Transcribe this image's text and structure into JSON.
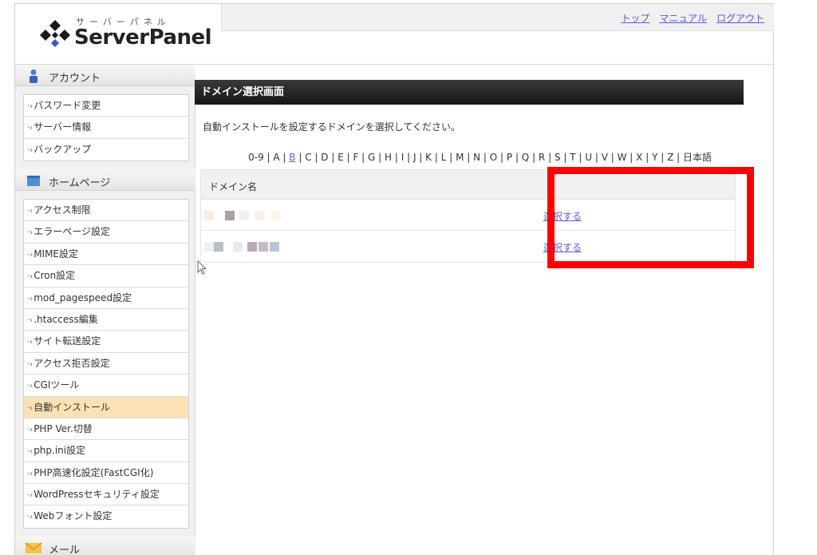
{
  "header": {
    "logo_kana": "サーバーパネル",
    "logo_text": "ServerPanel",
    "links": [
      "トップ",
      "マニュアル",
      "ログアウト"
    ]
  },
  "sidebar": {
    "account": {
      "title": "アカウント",
      "items": [
        "パスワード変更",
        "サーバー情報",
        "バックアップ"
      ]
    },
    "homepage": {
      "title": "ホームページ",
      "items": [
        "アクセス制限",
        "エラーページ設定",
        "MIME設定",
        "Cron設定",
        "mod_pagespeed設定",
        ".htaccess編集",
        "サイト転送設定",
        "アクセス拒否設定",
        "CGIツール",
        "自動インストール",
        "PHP Ver.切替",
        "php.ini設定",
        "PHP高速化設定(FastCGI化)",
        "WordPressセキュリティ設定",
        "Webフォント設定"
      ],
      "active_index": 9
    },
    "mail": {
      "title": "メール"
    }
  },
  "main": {
    "title": "ドメイン選択画面",
    "intro": "自動インストールを設定するドメインを選択してください。",
    "alphabet": "0-9 | A | B | C | D | E | F | G | H | I | J | K | L | M | N | O | P | Q | R | S | T | U | V | W | X | Y | Z | 日本語",
    "alphabet_selected": "B",
    "table": {
      "header": "ドメイン名",
      "rows": [
        {
          "select_label": "選択する"
        },
        {
          "select_label": "選択する"
        }
      ]
    }
  },
  "colors": {
    "link": "#5a5adc",
    "active_menu": "#fbe2b6",
    "highlight": "#ff0000",
    "title_bar": "#1e1e1e"
  },
  "icons": [
    "logo-diamond-icon",
    "account-person-icon",
    "homepage-icon",
    "mail-envelope-icon",
    "menu-arrow-icon",
    "mouse-cursor-icon"
  ]
}
